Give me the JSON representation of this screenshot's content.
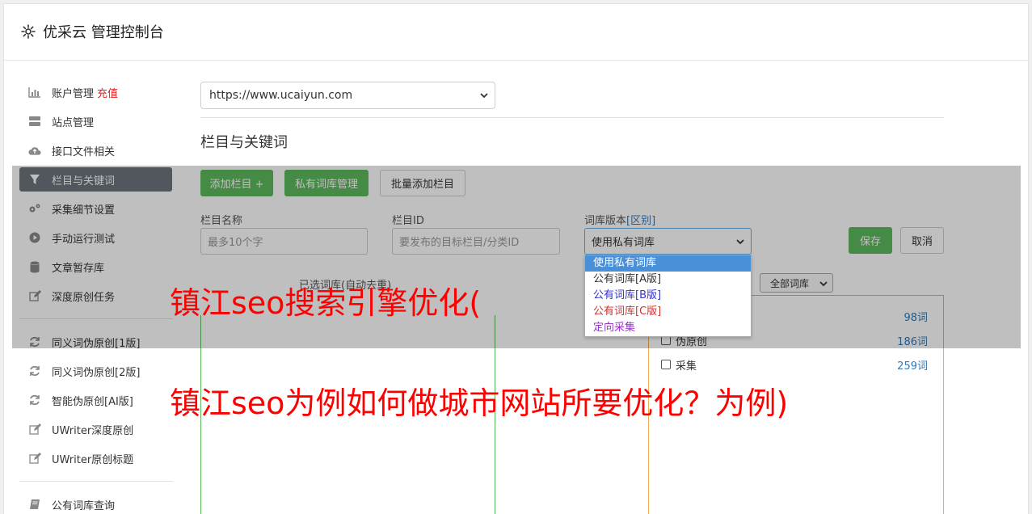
{
  "header": {
    "title": "优采云 管理控制台",
    "icon": "gear-icon"
  },
  "sidebar": {
    "items": [
      {
        "label": "账户管理",
        "badge": "充值",
        "icon": "bar-chart-icon"
      },
      {
        "label": "站点管理",
        "icon": "server-icon"
      },
      {
        "label": "接口文件相关",
        "icon": "cloud-upload-icon"
      },
      {
        "label": "栏目与关键词",
        "icon": "filter-icon",
        "active": true
      },
      {
        "label": "采集细节设置",
        "icon": "gears-icon"
      },
      {
        "label": "手动运行测试",
        "icon": "play-circle-icon"
      },
      {
        "label": "文章暂存库",
        "icon": "database-icon"
      },
      {
        "label": "深度原创任务",
        "icon": "edit-icon"
      },
      {
        "label": "同义词伪原创[1版]",
        "icon": "refresh-icon"
      },
      {
        "label": "同义词伪原创[2版]",
        "icon": "refresh-icon"
      },
      {
        "label": "智能伪原创[AI版]",
        "icon": "refresh-icon"
      },
      {
        "label": "UWriter深度原创",
        "icon": "edit-icon"
      },
      {
        "label": "UWriter原创标题",
        "icon": "edit-icon"
      },
      {
        "label": "公有词库查询",
        "icon": "book-icon"
      }
    ]
  },
  "main": {
    "site_select_value": "https://www.ucaiyun.com",
    "section_title": "栏目与关键词",
    "buttons": {
      "add_column": "添加栏目 +",
      "private_lib": "私有词库管理",
      "bulk_add": "批量添加栏目",
      "save": "保存",
      "cancel": "取消"
    },
    "fields": {
      "column_name_label": "栏目名称",
      "column_name_placeholder": "最多10个字",
      "column_id_label": "栏目ID",
      "column_id_placeholder": "要发布的目标栏目/分类ID",
      "lib_version_label": "词库版本",
      "lib_version_link": "[区别]",
      "lib_version_value": "使用私有词库"
    },
    "dropdown_options": [
      {
        "label": "使用私有词库",
        "color": "#ffffff",
        "selected": true
      },
      {
        "label": "公有词库[A版]",
        "color": "#333333"
      },
      {
        "label": "公有词库[B版]",
        "color": "#3333cc"
      },
      {
        "label": "公有词库[C版]",
        "color": "#cc3333"
      },
      {
        "label": "定向采集",
        "color": "#9933cc"
      }
    ],
    "dup_label": "已选词库(自动去重)",
    "filter_select_value": "全部词库",
    "categories": [
      {
        "name": "",
        "count": "98词"
      },
      {
        "name": "伪原创",
        "count": "186词"
      },
      {
        "name": "采集",
        "count": "259词"
      }
    ]
  },
  "headlines": {
    "line1": "镇江seo搜索引擎优化(",
    "line2": "镇江seo为例如何做城市网站所要优化？为例)"
  },
  "colors": {
    "accent_green": "#5cb85c",
    "active_nav": "#6c757d",
    "headline_red": "#ff0000"
  }
}
